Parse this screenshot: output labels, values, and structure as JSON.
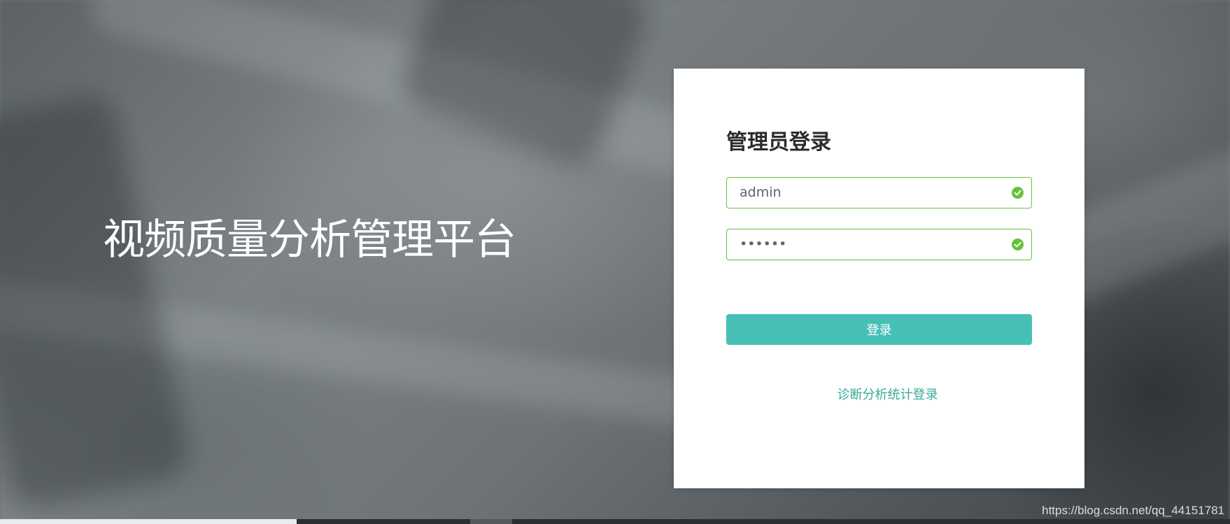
{
  "platform": {
    "title": "视频质量分析管理平台"
  },
  "login": {
    "heading": "管理员登录",
    "username_value": "admin",
    "password_value": "••••••",
    "submit_label": "登录",
    "alt_link_label": "诊断分析统计登录",
    "valid_icon": "check-circle-icon"
  },
  "watermark": {
    "text": "https://blog.csdn.net/qq_44151781"
  },
  "colors": {
    "accent": "#46c0b5",
    "valid": "#67c23a",
    "link": "#3aa99b"
  }
}
